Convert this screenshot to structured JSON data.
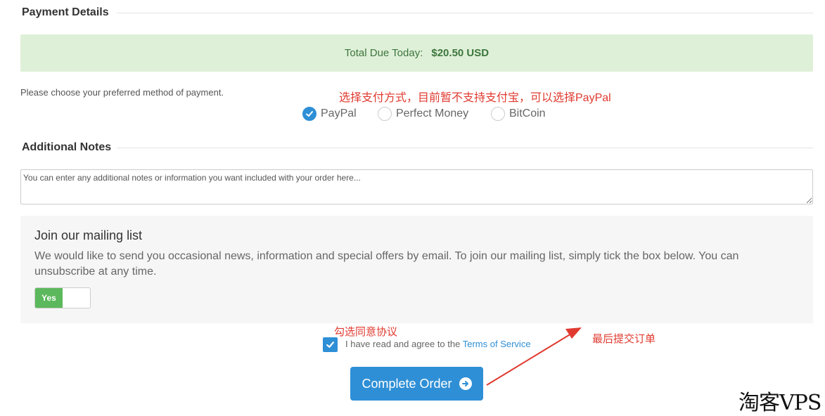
{
  "payment": {
    "title": "Payment Details",
    "total_label": "Total Due Today:",
    "total_amount": "$20.50 USD",
    "help": "Please choose your preferred method of payment.",
    "methods": [
      {
        "label": "PayPal",
        "checked": true
      },
      {
        "label": "Perfect Money",
        "checked": false
      },
      {
        "label": "BitCoin",
        "checked": false
      }
    ]
  },
  "notes": {
    "title": "Additional Notes",
    "placeholder": "You can enter any additional notes or information you want included with your order here..."
  },
  "mailing": {
    "title": "Join our mailing list",
    "description": "We would like to send you occasional news, information and special offers by email. To join our mailing list, simply tick the box below. You can unsubscribe at any time.",
    "toggle_label": "Yes"
  },
  "terms": {
    "text": "I have read and agree to the",
    "link": "Terms of Service"
  },
  "complete_button": {
    "label": "Complete Order",
    "icon": "arrow-circle-right-icon"
  },
  "annotations": {
    "payment_hint": "选择支付方式，目前暂不支持支付宝，可以选择PayPal",
    "terms_hint": "勾选同意协议",
    "submit_hint": "最后提交订单"
  },
  "watermark": "淘客VPS",
  "colors": {
    "accent": "#2e8fd6",
    "success_bg": "#dff0d8",
    "success_text": "#3c763d",
    "toggle_on": "#5cb85c",
    "annotation": "#e03a2f"
  }
}
